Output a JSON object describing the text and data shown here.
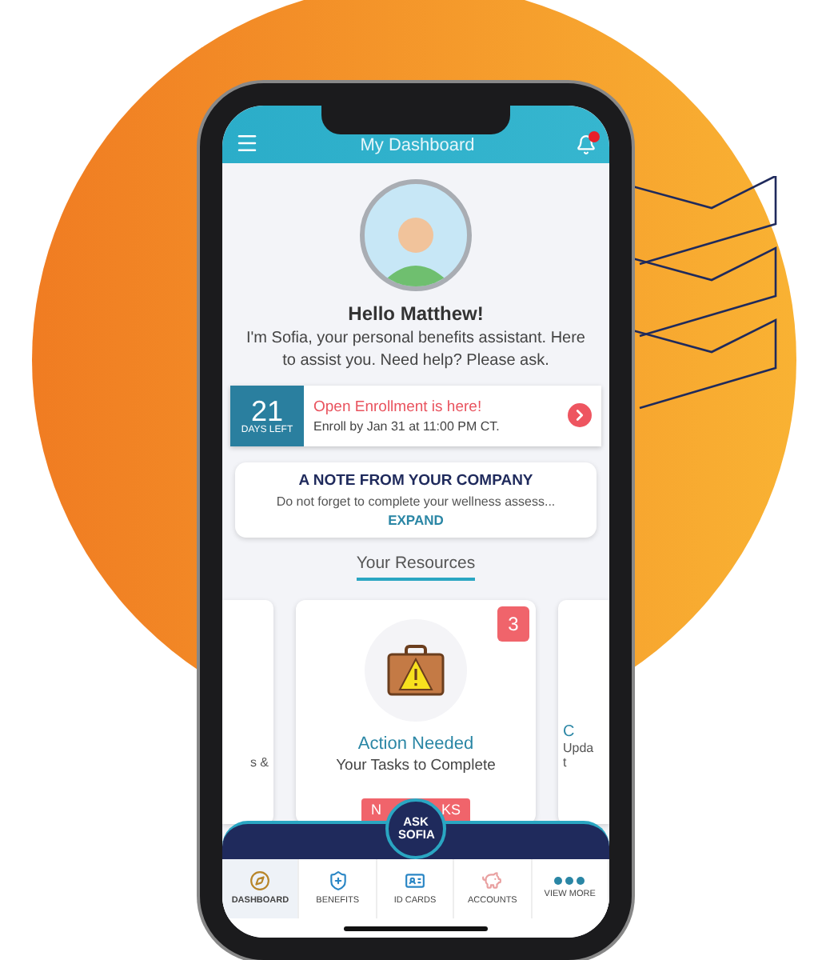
{
  "header": {
    "title": "My Dashboard",
    "notification": true
  },
  "assistant": {
    "greeting": "Hello Matthew!",
    "message": "I'm Sofia, your personal benefits assistant. Here to assist you. Need help? Please ask."
  },
  "enrollment": {
    "days": "21",
    "days_label": "DAYS LEFT",
    "title": "Open Enrollment is here!",
    "detail": "Enroll by Jan 31 at 11:00 PM CT."
  },
  "note": {
    "title": "A NOTE FROM YOUR COMPANY",
    "text": "Do not forget to complete your wellness assess...",
    "action": "EXPAND"
  },
  "resources": {
    "title": "Your Resources",
    "cards": [
      {
        "kind": "partial-left",
        "lines": [
          "s &"
        ]
      },
      {
        "kind": "main",
        "badge": "3",
        "title": "Action Needed",
        "subtitle": "Your Tasks to Complete",
        "button": [
          "N",
          "KS"
        ]
      },
      {
        "kind": "partial-right",
        "title": "C",
        "lines": [
          "Upda",
          "t"
        ]
      }
    ]
  },
  "ask": {
    "label": "ASK SOFIA"
  },
  "nav": [
    {
      "label": "DASHBOARD",
      "selected": true
    },
    {
      "label": "BENEFITS",
      "selected": false
    },
    {
      "label": "ID CARDS",
      "selected": false
    },
    {
      "label": "ACCOUNTS",
      "selected": false
    },
    {
      "label": "VIEW MORE",
      "selected": false
    }
  ]
}
